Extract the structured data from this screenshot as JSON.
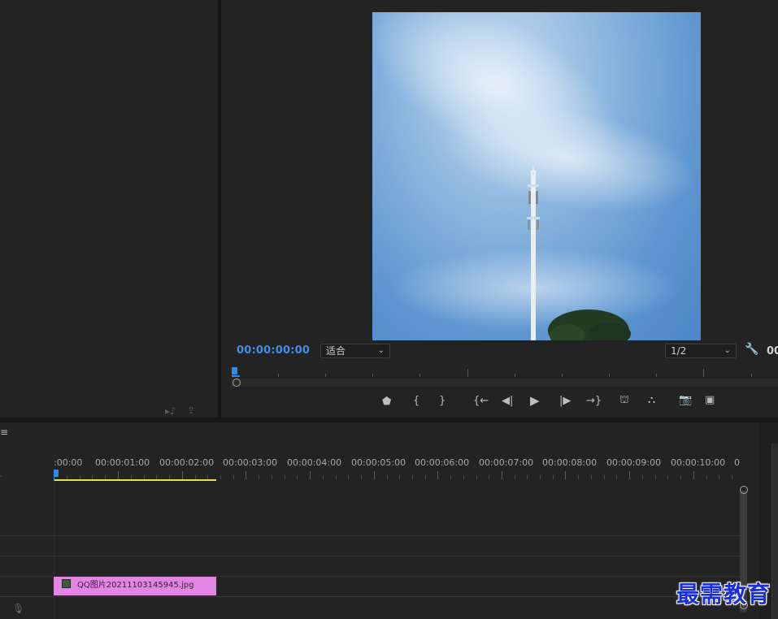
{
  "program_monitor": {
    "timecode": "00:00:00:00",
    "fit_dropdown": "适合",
    "resolution_dropdown": "1/2",
    "right_timecode_partial": "00"
  },
  "timeline": {
    "ruler_labels": [
      ":00:00",
      "00:00:01:00",
      "00:00:02:00",
      "00:00:03:00",
      "00:00:04:00",
      "00:00:05:00",
      "00:00:06:00",
      "00:00:07:00",
      "00:00:08:00",
      "00:00:09:00",
      "00:00:10:00",
      "0"
    ],
    "clip_name": "QQ图片20211103145945.jpg",
    "header_glyph": "≡"
  },
  "colors": {
    "accent_blue": "#3f8fe6",
    "clip_pink": "#e386e3",
    "work_area_yellow": "#e8e24a",
    "playhead_blue": "#2d8ceb"
  },
  "watermark": "最需教育"
}
